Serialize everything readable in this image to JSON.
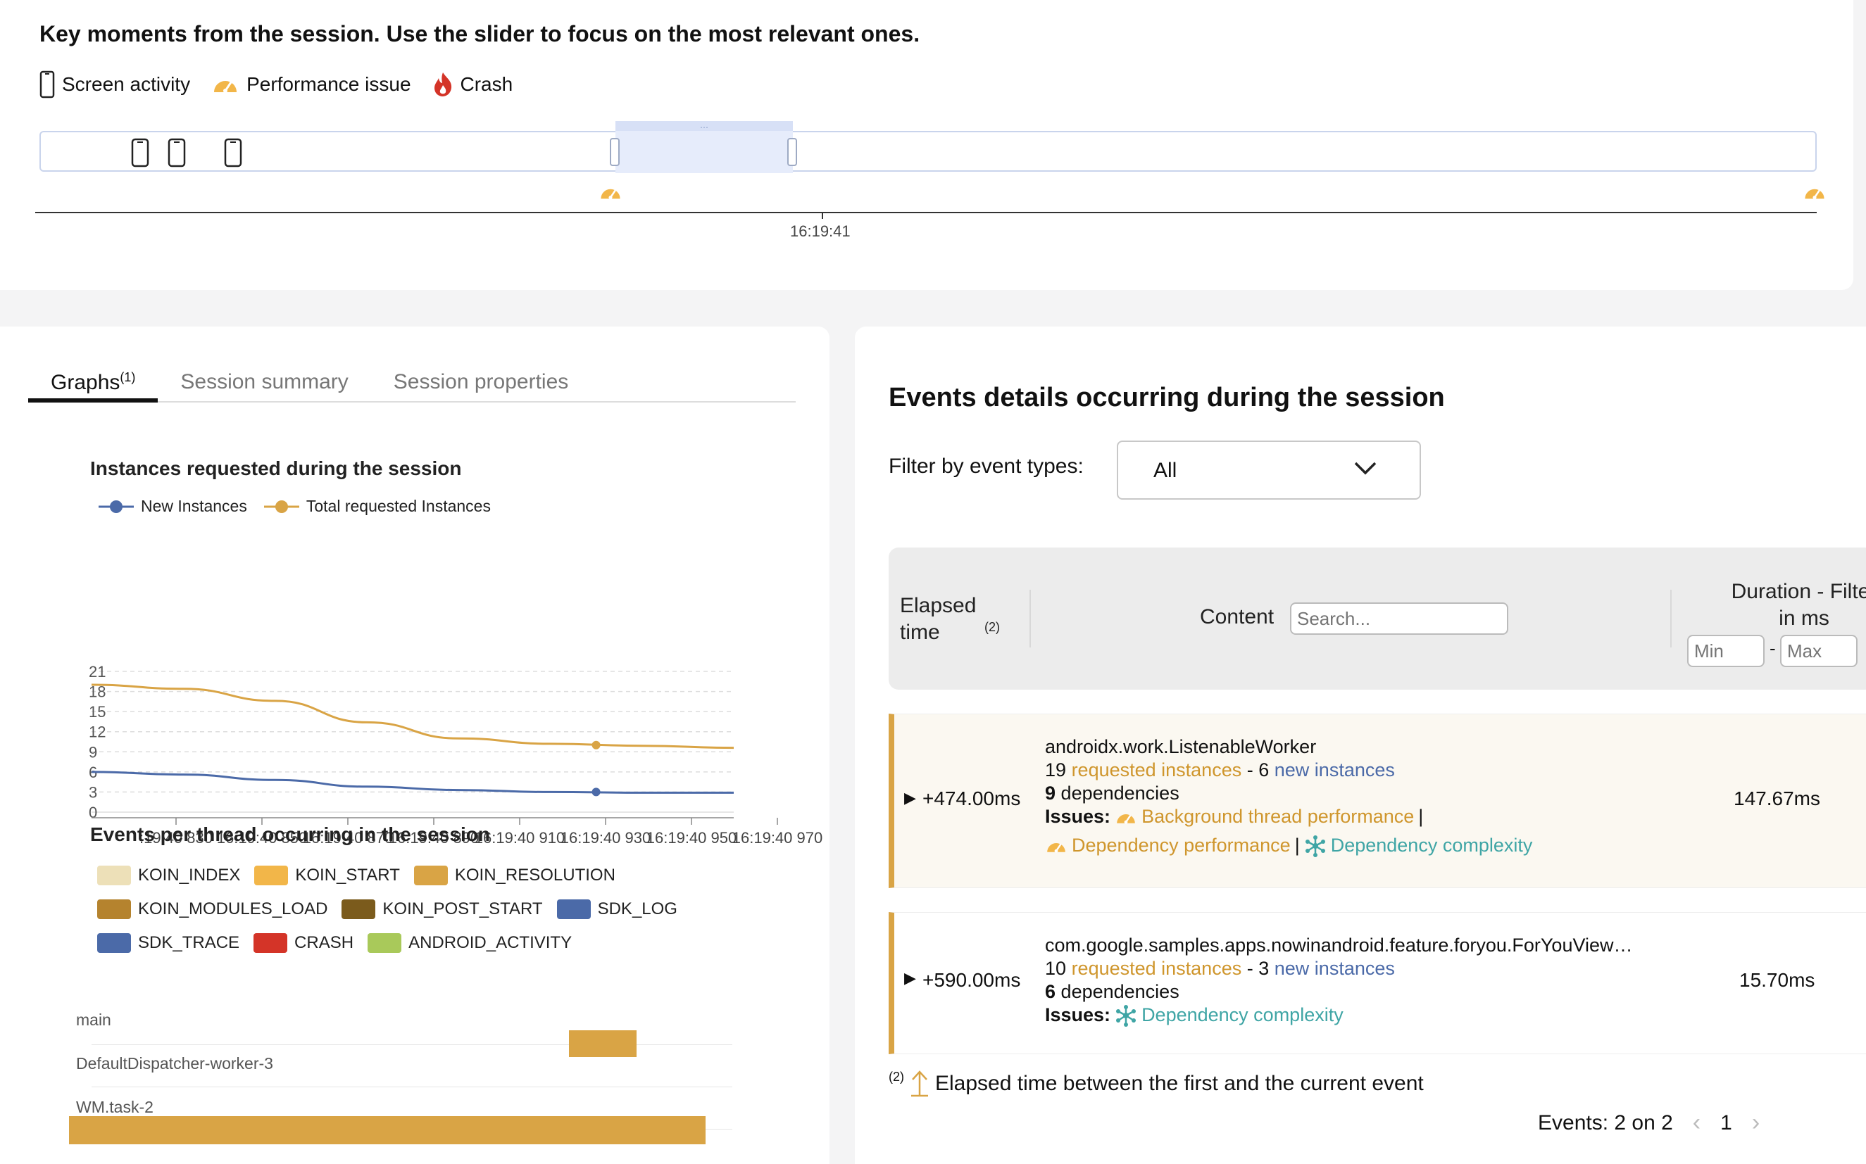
{
  "timeline": {
    "heading": "Key moments from the session. Use the slider to focus on the most relevant ones.",
    "legend": [
      {
        "label": "Screen activity",
        "icon": "phone-icon"
      },
      {
        "label": "Performance issue",
        "icon": "speedometer-icon"
      },
      {
        "label": "Crash",
        "icon": "flame-icon"
      }
    ],
    "axis_label": "16:19:41",
    "slider_grip": "⋯"
  },
  "tabs": [
    {
      "label": "Graphs",
      "sup": "(1)"
    },
    {
      "label": "Session summary",
      "sup": ""
    },
    {
      "label": "Session properties",
      "sup": ""
    }
  ],
  "instances_chart": {
    "title": "Instances requested during the session",
    "legend": [
      "New Instances",
      "Total requested Instances"
    ]
  },
  "chart_data": {
    "type": "line",
    "title": "Instances requested during the session",
    "x": [
      "16:19:40 830",
      "16:19:40 850",
      "16:19:40 870",
      "16:19:40 890",
      "16:19:40 910",
      "16:19:40 930",
      "16:19:40 950",
      "16:19:40 970"
    ],
    "x_labels_shown": [
      ":19:40 830",
      "16:19:40 850",
      "16:19:40 870",
      "16:19:40 890",
      "16:19:40 910",
      "16:19:40 930",
      "16:19:40 950",
      "16:19:40 970"
    ],
    "y_ticks": [
      0,
      3,
      6,
      9,
      12,
      15,
      18,
      21
    ],
    "ylim": [
      0,
      21
    ],
    "grid": true,
    "legend_position": "top-left",
    "series": [
      {
        "name": "New Instances",
        "color": "#4b6aa8",
        "values": [
          6,
          5.6,
          4.8,
          3.8,
          3.3,
          3,
          2.9,
          2.9
        ]
      },
      {
        "name": "Total requested Instances",
        "color": "#d9a445",
        "values": [
          19,
          18.4,
          16.6,
          13.4,
          11,
          10.2,
          9.9,
          9.6
        ]
      }
    ],
    "markers": [
      {
        "series": "New Instances",
        "x_index": 5.5,
        "value": 3
      },
      {
        "series": "Total requested Instances",
        "x_index": 5.5,
        "value": 10
      }
    ]
  },
  "threads_chart": {
    "title": "Events per thread occurring in the session",
    "legend": [
      {
        "label": "KOIN_INDEX",
        "color": "#ede0b8"
      },
      {
        "label": "KOIN_START",
        "color": "#f2b649"
      },
      {
        "label": "KOIN_RESOLUTION",
        "color": "#d9a445"
      },
      {
        "label": "KOIN_MODULES_LOAD",
        "color": "#b5832e"
      },
      {
        "label": "KOIN_POST_START",
        "color": "#7b5b1c"
      },
      {
        "label": "SDK_LOG",
        "color": "#4b6aa8"
      },
      {
        "label": "SDK_TRACE",
        "color": "#4b6aa8"
      },
      {
        "label": "CRASH",
        "color": "#d43428"
      },
      {
        "label": "ANDROID_ACTIVITY",
        "color": "#a9c95a"
      }
    ],
    "threads": [
      "main",
      "DefaultDispatcher-worker-3",
      "WM.task-2"
    ]
  },
  "events_panel": {
    "title": "Events details occurring during the session",
    "filter_label": "Filter by event types:",
    "filter_value": "All",
    "columns": {
      "elapsed": "Elapsed time",
      "elapsed_sup": "(2)",
      "content": "Content",
      "search_placeholder": "Search...",
      "duration_line1": "Duration - Filter",
      "duration_line2": "in ms",
      "min_placeholder": "Min",
      "max_placeholder": "Max"
    },
    "rows": [
      {
        "elapsed": "+474.00ms",
        "name": "androidx.work.ListenableWorker",
        "requested_count": "19",
        "requested_label": "requested instances",
        "sep": " - ",
        "new_count": "6",
        "new_label": "new instances",
        "dependencies_count": "9",
        "dependencies_label": "dependencies",
        "issues_label": "Issues:",
        "issue1": "Background thread performance",
        "issue2": "Dependency performance",
        "issue3": "Dependency complexity",
        "duration": "147.67ms"
      },
      {
        "elapsed": "+590.00ms",
        "name": "com.google.samples.apps.nowinandroid.feature.foryou.ForYouView…",
        "requested_count": "10",
        "requested_label": "requested instances",
        "sep": " - ",
        "new_count": "3",
        "new_label": "new instances",
        "dependencies_count": "6",
        "dependencies_label": "dependencies",
        "issues_label": "Issues:",
        "issue1": "Dependency complexity",
        "duration": "15.70ms"
      }
    ],
    "footnote_sup": "(2)",
    "footnote": "Elapsed time between the first and the current event",
    "pager": {
      "events_text": "Events: 2 on 2",
      "page": "1",
      "prev": "‹",
      "next": "›"
    }
  },
  "colors": {
    "accent_orange": "#d9a445",
    "accent_blue": "#4b6aa8",
    "accent_teal": "#3fa5a5",
    "slider_fill": "#e6ecfb"
  }
}
